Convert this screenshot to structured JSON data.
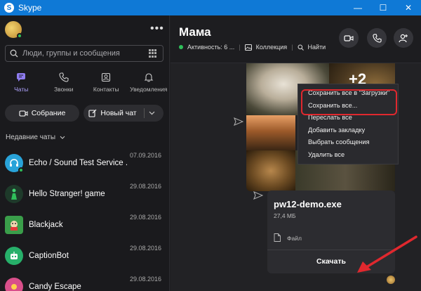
{
  "window": {
    "title": "Skype",
    "controls": [
      "—",
      "☐",
      "✕"
    ]
  },
  "sidebar": {
    "search_placeholder": "Люди, группы и сообщения",
    "tabs": [
      {
        "label": "Чаты",
        "icon": "chat-icon",
        "active": true
      },
      {
        "label": "Звонки",
        "icon": "phone-icon"
      },
      {
        "label": "Контакты",
        "icon": "contacts-icon"
      },
      {
        "label": "Уведомления",
        "icon": "bell-icon"
      }
    ],
    "meeting_button": "Собрание",
    "new_chat_button": "Новый чат",
    "recent_label": "Недавние чаты",
    "chats": [
      {
        "name": "Echo / Sound Test Service .",
        "date": "07.09.2016"
      },
      {
        "name": "Hello Stranger! game",
        "date": "29.08.2016"
      },
      {
        "name": "Blackjack",
        "date": "29.08.2016"
      },
      {
        "name": "CaptionBot",
        "date": "29.08.2016"
      },
      {
        "name": "Candy Escape",
        "date": "29.08.2016"
      }
    ]
  },
  "conversation": {
    "title": "Мама",
    "status": "Активность: 6 ...",
    "collection": "Коллекция",
    "find": "Найти",
    "more_photos": "+2"
  },
  "context_menu": {
    "items": [
      "Сохранить все в \"Загрузки\"",
      "Сохранить все...",
      "Переслать все",
      "Добавить закладку",
      "Выбрать сообщения",
      "Удалить все"
    ]
  },
  "file": {
    "name": "pw12-demo.exe",
    "size": "27,4 МБ",
    "type_label": "Файл",
    "download": "Скачать"
  },
  "colors": {
    "titlebar": "#0f79d6",
    "accent": "#b0a4ff",
    "highlight": "#e0282e",
    "online": "#2fbf5a"
  }
}
